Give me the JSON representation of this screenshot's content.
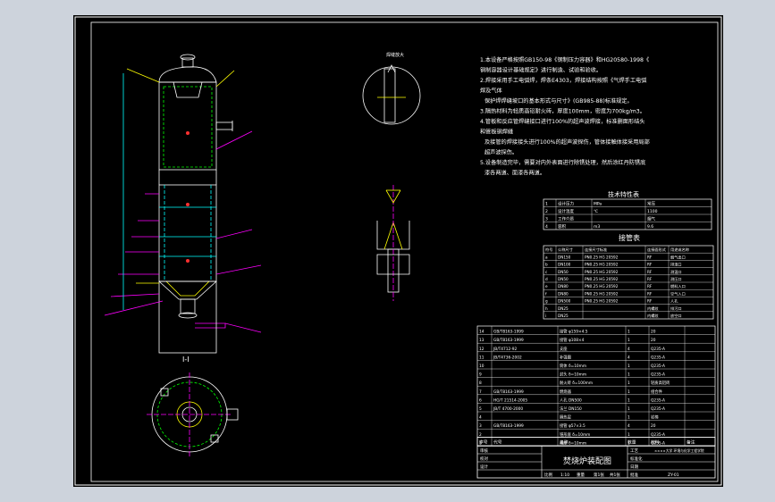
{
  "drawing": {
    "title": "焚烧炉装配图",
    "section_view_label": "I-I",
    "detail_label": "焊缝放大",
    "parts_table_title": "接管表",
    "notes": [
      "1.本设备严格按照GB150-98《钢制压力容器》和HG20580-1998《",
      "钢制容器设计基础规定》进行制造、试验和验收。",
      "2.焊接采用手工电弧焊，焊条E4303，焊接结构按照《气焊手工电弧",
      "焊及气体",
      "保护焊焊缝坡口的基本形式与尺寸》(GB985-88)标准规定。",
      "3.隔热材料为轻质高铝耐火砖，厚度100mm，密度为700kg/m3。",
      "4.管板和反应管焊缝接口进行100%的超声波焊接，标准删面形结头",
      "和管板钢焊缝",
      "及接管的焊接接头进行100%的超声波探伤，管体接触体接采用局部",
      "超声波探伤。",
      "5.设备制造完毕，需要对内外表面进行除锈处理，然后涂红丹防锈底",
      "漆各两道、面漆各两道。"
    ],
    "tech_table": {
      "title": "技术特性表",
      "rows": [
        [
          "1",
          "设计压力",
          "MPa",
          "常压"
        ],
        [
          "2",
          "设计温度",
          "℃",
          "1100"
        ],
        [
          "3",
          "工作介质",
          "",
          "烟气"
        ],
        [
          "4",
          "容积",
          "m3",
          "9.6"
        ]
      ]
    },
    "nozzle_table": {
      "header": [
        "符号",
        "公称尺寸",
        "连接尺寸标准",
        "连接面形式",
        "用途或名称"
      ],
      "rows": [
        [
          "a",
          "DN150",
          "PN0.25 HG 20592",
          "RF",
          "烟气出口"
        ],
        [
          "b",
          "DN100",
          "PN0.25 HG 20592",
          "RF",
          "排渣口"
        ],
        [
          "c",
          "DN50",
          "PN0.25 HG 20592",
          "RF",
          "测温口"
        ],
        [
          "d",
          "DN50",
          "PN0.25 HG 20592",
          "RF",
          "测压口"
        ],
        [
          "e",
          "DN80",
          "PN0.25 HG 20592",
          "RF",
          "燃料入口"
        ],
        [
          "f",
          "DN80",
          "PN0.25 HG 20592",
          "RF",
          "空气入口"
        ],
        [
          "g",
          "DN500",
          "PN0.25 HG 20592",
          "RF",
          "人孔"
        ],
        [
          "h",
          "DN25",
          "",
          "内螺纹",
          "排污口"
        ],
        [
          "i",
          "DN25",
          "",
          "内螺纹",
          "放空口"
        ]
      ]
    },
    "bom": {
      "header": [
        "序号",
        "代号",
        "名称",
        "数量",
        "材料",
        "备注"
      ],
      "rows": [
        [
          "14",
          "GB/T8163-1999",
          "接管 φ159×4.5",
          "1",
          "20",
          ""
        ],
        [
          "13",
          "GB/T8163-1999",
          "接管 φ108×4",
          "1",
          "20",
          ""
        ],
        [
          "12",
          "JB/T4712-92",
          "支座",
          "4",
          "Q235-A",
          ""
        ],
        [
          "11",
          "JB/T4736-2002",
          "补强圈",
          "4",
          "Q235-A",
          ""
        ],
        [
          "10",
          "",
          "筒体 δ=10mm",
          "1",
          "Q235-A",
          ""
        ],
        [
          "9",
          "",
          "封头 δ=10mm",
          "1",
          "Q235-A",
          ""
        ],
        [
          "8",
          "",
          "耐火砖 δ=100mm",
          "1",
          "轻质高铝砖",
          ""
        ],
        [
          "7",
          "GB/T8163-1999",
          "燃烧器",
          "1",
          "组合件",
          ""
        ],
        [
          "6",
          "HG/T 21514-2005",
          "人孔 DN500",
          "1",
          "Q235-A",
          ""
        ],
        [
          "5",
          "JB/T 4700-2000",
          "法兰 DN150",
          "1",
          "Q235-A",
          ""
        ],
        [
          "4",
          "",
          "隔热层",
          "1",
          "岩棉",
          ""
        ],
        [
          "3",
          "GB/T8163-1999",
          "接管 φ57×3.5",
          "4",
          "20",
          ""
        ],
        [
          "2",
          "",
          "锥形底 δ=10mm",
          "1",
          "Q235-A",
          ""
        ],
        [
          "1",
          "",
          "裙座 δ=10mm",
          "1",
          "Q235-A",
          ""
        ]
      ]
    },
    "title_block": {
      "rows_left": [
        "审核",
        "校对",
        "设计"
      ],
      "rows_right": [
        "工艺",
        "标准化",
        "日期",
        "批准"
      ],
      "scale_label": "比例",
      "scale": "1:10",
      "sheet_label": "第1张",
      "sheet_total": "共1张",
      "weight_label": "重量",
      "school": "××××大学 环境与化学工程学院",
      "drawing_no": "ZY-01"
    }
  },
  "colors": {
    "background": "#cdd3dc",
    "sheet": "#000000",
    "outline": "#ffffff",
    "cyan": "#00ffff",
    "yellow": "#ffff00",
    "green": "#00ff00",
    "magenta": "#ff00ff",
    "red": "#ff3030"
  }
}
